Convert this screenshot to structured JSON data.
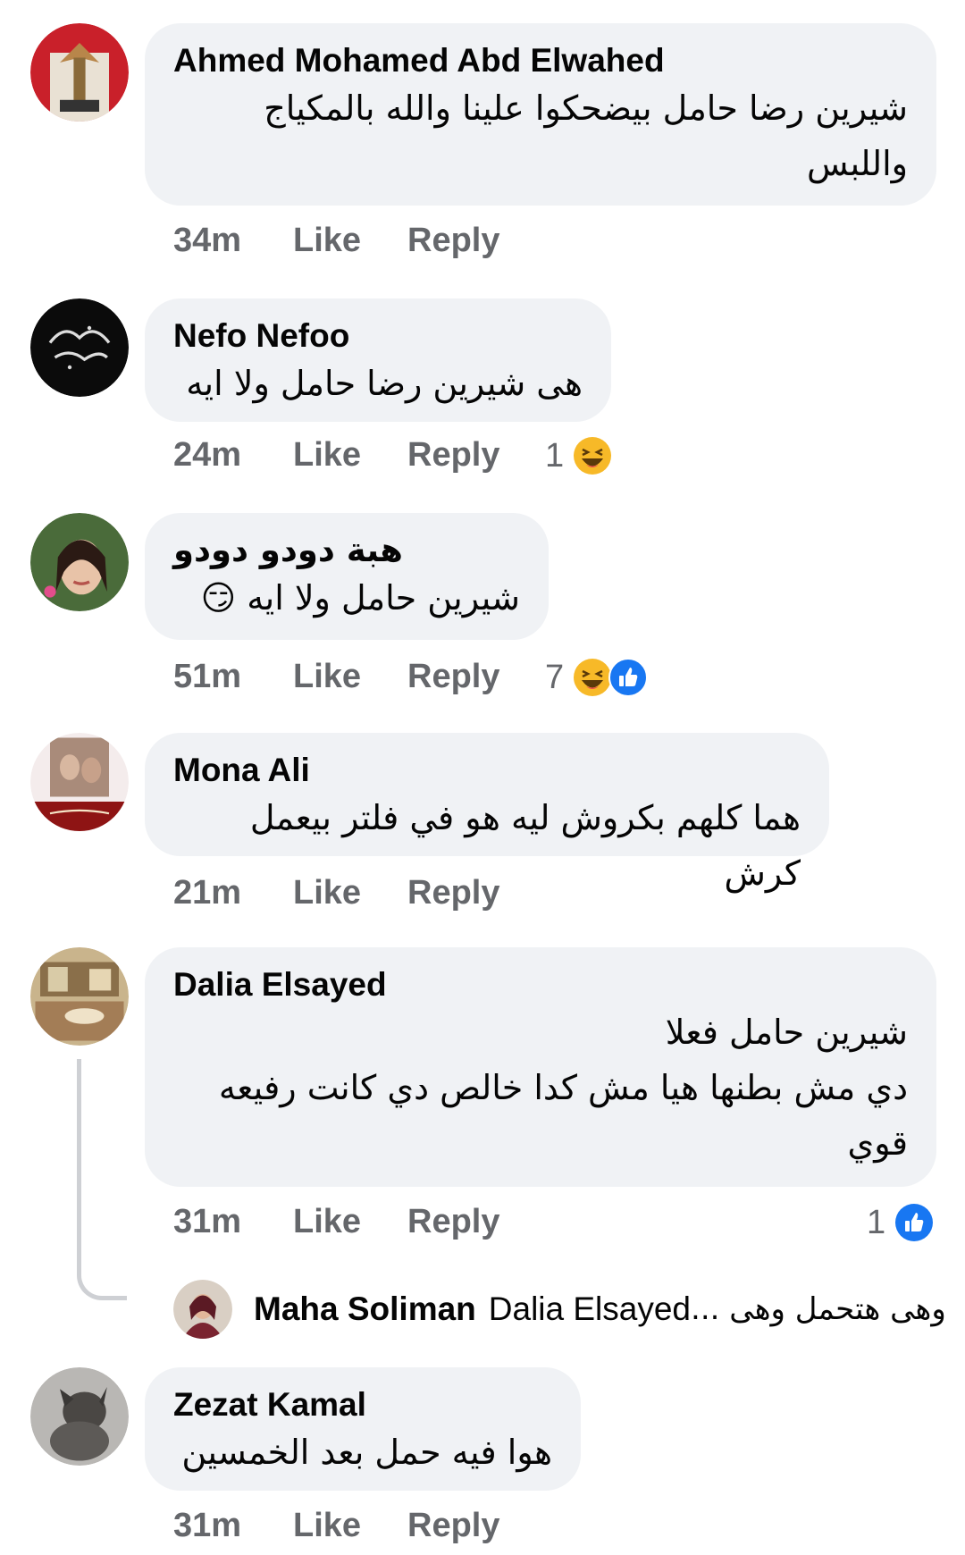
{
  "comments": [
    {
      "name": "Ahmed Mohamed Abd Elwahed",
      "text_lines": [
        "شيرين رضا حامل بيضحكوا علينا والله بالمكياج",
        "واللبس"
      ],
      "time": "34m",
      "like": "Like",
      "reply": "Reply",
      "reaction_count": "",
      "reactions": []
    },
    {
      "name": "Nefo Nefoo",
      "text_lines": [
        "هى شيرين رضا حامل ولا ايه"
      ],
      "time": "24m",
      "like": "Like",
      "reply": "Reply",
      "reaction_count": "1",
      "reactions": [
        "laugh-icon"
      ]
    },
    {
      "name": "هبة دودو دودو",
      "text_lines": [
        "شيرين حامل ولا ايه 😏"
      ],
      "time": "51m",
      "like": "Like",
      "reply": "Reply",
      "reaction_count": "7",
      "reactions": [
        "laugh-icon",
        "like-icon"
      ]
    },
    {
      "name": "Mona Ali",
      "text_lines": [
        "هما كلهم بكروش ليه هو في فلتر بيعمل كرش"
      ],
      "time": "21m",
      "like": "Like",
      "reply": "Reply",
      "reaction_count": "",
      "reactions": []
    },
    {
      "name": "Dalia Elsayed",
      "text_lines": [
        "شيرين حامل فعلا",
        "دي مش بطنها هيا مش كدا خالص دي كانت رفيعه",
        "قوي"
      ],
      "time": "31m",
      "like": "Like",
      "reply": "Reply",
      "reaction_count": "1",
      "reactions": [
        "like-icon"
      ]
    },
    {
      "name": "Zezat Kamal",
      "text_lines": [
        "هوا فيه حمل بعد الخمسين"
      ],
      "time": "31m",
      "like": "Like",
      "reply": "Reply",
      "reaction_count": "",
      "reactions": []
    }
  ],
  "reply_preview": {
    "name": "Maha Soliman",
    "mention": "Dalia Elsayed",
    "text": "وهى هتحمل وهى ..."
  },
  "colors": {
    "bubble": "#f0f2f5",
    "meta_text": "#65676b",
    "like_blue": "#1877f2",
    "laugh_yellow": "#f7b928"
  }
}
